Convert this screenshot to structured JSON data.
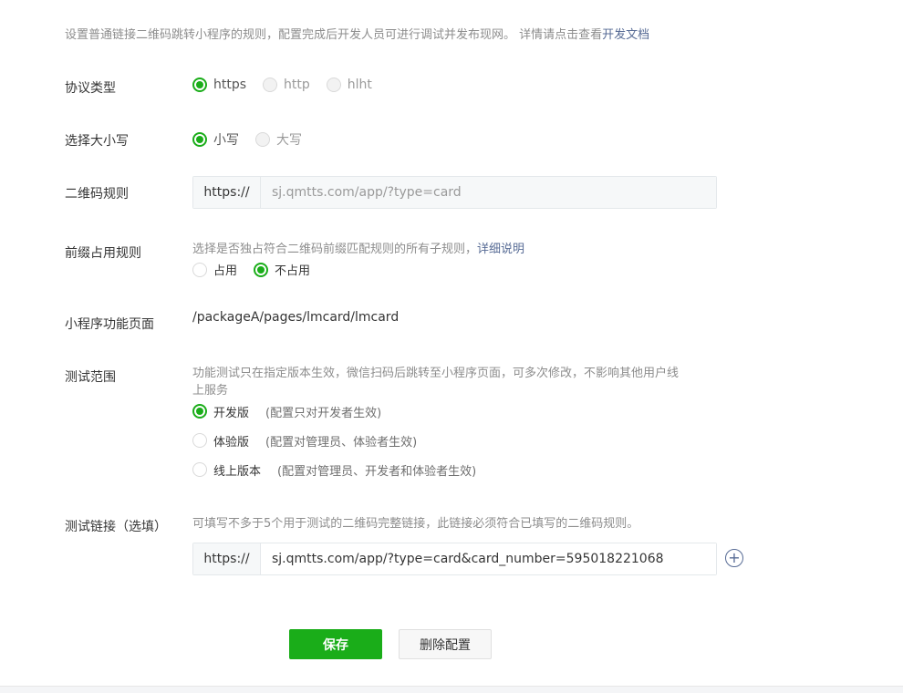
{
  "intro": {
    "text": "设置普通链接二维码跳转小程序的规则，配置完成后开发人员可进行调试并发布现网。 详情请点击查看",
    "link": "开发文档"
  },
  "protocol": {
    "label": "协议类型",
    "options": [
      "https",
      "http",
      "hlht"
    ],
    "selected": "https"
  },
  "case": {
    "label": "选择大小写",
    "options": [
      "小写",
      "大写"
    ],
    "selected": "小写"
  },
  "qr_rule": {
    "label": "二维码规则",
    "prefix": "https://",
    "placeholder": "sj.qmtts.com/app/?type=card"
  },
  "prefix_rule": {
    "label": "前缀占用规则",
    "desc": "选择是否独占符合二维码前缀匹配规则的所有子规则，",
    "desc_link": "详细说明",
    "options": [
      "占用",
      "不占用"
    ],
    "selected": "不占用"
  },
  "page": {
    "label": "小程序功能页面",
    "value": "/packageA/pages/lmcard/lmcard"
  },
  "test_scope": {
    "label": "测试范围",
    "desc_line1": "功能测试只在指定版本生效，微信扫码后跳转至小程序页面，可多次修改，不影响其他用户线",
    "desc_line2": "上服务",
    "options": [
      {
        "name": "开发版",
        "note": "(配置只对开发者生效)"
      },
      {
        "name": "体验版",
        "note": "(配置对管理员、体验者生效)"
      },
      {
        "name": "线上版本",
        "note": "(配置对管理员、开发者和体验者生效)"
      }
    ],
    "selected": "开发版"
  },
  "test_link": {
    "label": "测试链接（选填）",
    "desc": "可填写不多于5个用于测试的二维码完整链接，此链接必须符合已填写的二维码规则。",
    "prefix": "https://",
    "value": "sj.qmtts.com/app/?type=card&card_number=595018221068"
  },
  "actions": {
    "save": "保存",
    "delete": "删除配置"
  },
  "colors": {
    "accent": "#1aad19",
    "link": "#576b95"
  }
}
